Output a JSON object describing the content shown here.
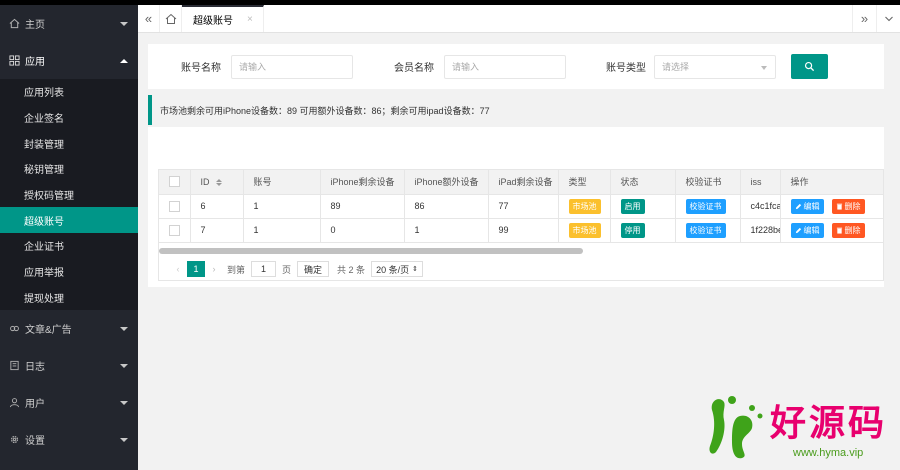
{
  "sidebar": {
    "top": [
      {
        "label": "主页",
        "icon": "home-icon"
      },
      {
        "label": "应用",
        "icon": "apps-icon"
      }
    ],
    "sub": [
      {
        "label": "应用列表"
      },
      {
        "label": "企业签名"
      },
      {
        "label": "封装管理"
      },
      {
        "label": "秘钥管理"
      },
      {
        "label": "授权码管理"
      },
      {
        "label": "超级账号",
        "active": true
      },
      {
        "label": "企业证书"
      },
      {
        "label": "应用举报"
      },
      {
        "label": "提现处理"
      }
    ],
    "bottom": [
      {
        "label": "文章&广告",
        "icon": "link-icon"
      },
      {
        "label": "日志",
        "icon": "log-icon"
      },
      {
        "label": "用户",
        "icon": "user-icon"
      },
      {
        "label": "设置",
        "icon": "gear-icon"
      }
    ]
  },
  "tabs": {
    "active_label": "超级账号",
    "close": "×"
  },
  "search": {
    "account_label": "账号名称",
    "account_placeholder": "请输入",
    "member_label": "会员名称",
    "member_placeholder": "请输入",
    "type_label": "账号类型",
    "type_placeholder": "请选择"
  },
  "notice": "市场池剩余可用iPhone设备数：89 可用额外设备数：86；剩余可用ipad设备数：77",
  "table": {
    "headers": [
      "ID",
      "账号",
      "iPhone剩余设备",
      "iPhone额外设备",
      "iPad剩余设备",
      "类型",
      "状态",
      "校验证书",
      "iss",
      "操作"
    ],
    "rows": [
      {
        "id": "6",
        "account": "1",
        "iphone_left": "89",
        "iphone_extra": "86",
        "ipad_left": "77",
        "type": "市场池",
        "status": "启用",
        "cert": "校验证书",
        "iss": "c4c1fca",
        "edit": "编辑",
        "delete": "删除"
      },
      {
        "id": "7",
        "account": "1",
        "iphone_left": "0",
        "iphone_extra": "1",
        "ipad_left": "99",
        "type": "市场池",
        "status": "停用",
        "cert": "校验证书",
        "iss": "1f228be",
        "edit": "编辑",
        "delete": "删除"
      }
    ]
  },
  "pager": {
    "current": "1",
    "goto_label": "到第",
    "goto_value": "1",
    "page_unit": "页",
    "confirm": "确定",
    "total": "共 2 条",
    "page_size": "20 条/页"
  },
  "watermark": {
    "text": "好源码",
    "url": "www.hyma.vip"
  },
  "colors": {
    "accent": "#009688",
    "sidebar_bg": "#23262e",
    "yellow": "#fbc02d",
    "blue": "#1e9fff",
    "red": "#ff5722"
  }
}
